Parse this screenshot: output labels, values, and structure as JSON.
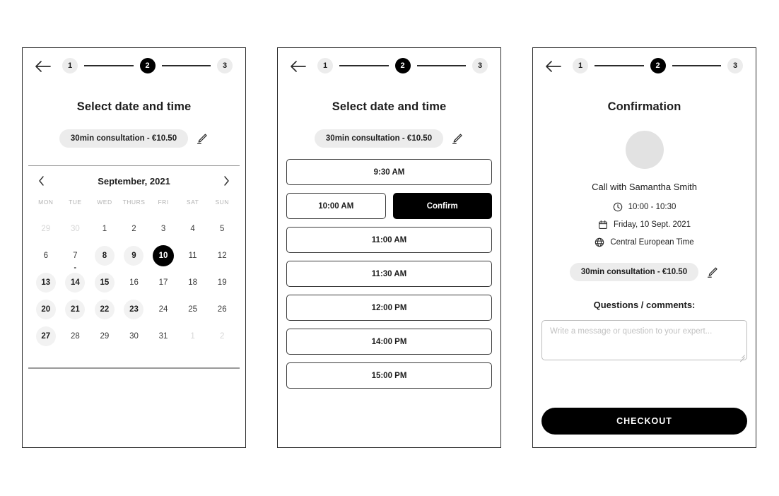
{
  "theme": {
    "background": "#ffffff",
    "card_border": "#2b2b2b",
    "accent_black": "#000000",
    "pill_gray": "#ececec",
    "available_gray": "#f2f2f2",
    "muted_text": "#d6d6d6",
    "avatar_gray": "#e2e2e2"
  },
  "panel1": {
    "back_icon": "arrow-left-icon",
    "steps": [
      {
        "label": "1",
        "active": false
      },
      {
        "label": "2",
        "active": true
      },
      {
        "label": "3",
        "active": false
      }
    ],
    "title": "Select date and time",
    "service_pill": "30min consultation - €10.50",
    "edit_icon": "pencil-icon",
    "calendar": {
      "prev_icon": "chevron-left-icon",
      "next_icon": "chevron-right-icon",
      "month_label": "September, 2021",
      "weekdays": [
        "MON",
        "TUE",
        "WED",
        "THURS",
        "FRI",
        "SAT",
        "SUN"
      ],
      "weeks": [
        [
          {
            "n": "29",
            "state": "muted"
          },
          {
            "n": "30",
            "state": "muted"
          },
          {
            "n": "1",
            "state": "normal"
          },
          {
            "n": "2",
            "state": "normal"
          },
          {
            "n": "3",
            "state": "normal"
          },
          {
            "n": "4",
            "state": "normal"
          },
          {
            "n": "5",
            "state": "normal"
          }
        ],
        [
          {
            "n": "6",
            "state": "normal"
          },
          {
            "n": "7",
            "state": "normal",
            "dot": true
          },
          {
            "n": "8",
            "state": "avail"
          },
          {
            "n": "9",
            "state": "avail"
          },
          {
            "n": "10",
            "state": "selected"
          },
          {
            "n": "11",
            "state": "normal"
          },
          {
            "n": "12",
            "state": "normal"
          }
        ],
        [
          {
            "n": "13",
            "state": "avail"
          },
          {
            "n": "14",
            "state": "avail"
          },
          {
            "n": "15",
            "state": "avail"
          },
          {
            "n": "16",
            "state": "normal"
          },
          {
            "n": "17",
            "state": "normal"
          },
          {
            "n": "18",
            "state": "normal"
          },
          {
            "n": "19",
            "state": "normal"
          }
        ],
        [
          {
            "n": "20",
            "state": "avail"
          },
          {
            "n": "21",
            "state": "avail"
          },
          {
            "n": "22",
            "state": "avail"
          },
          {
            "n": "23",
            "state": "avail"
          },
          {
            "n": "24",
            "state": "normal"
          },
          {
            "n": "25",
            "state": "normal"
          },
          {
            "n": "26",
            "state": "normal"
          }
        ],
        [
          {
            "n": "27",
            "state": "avail"
          },
          {
            "n": "28",
            "state": "normal"
          },
          {
            "n": "29",
            "state": "normal"
          },
          {
            "n": "30",
            "state": "normal"
          },
          {
            "n": "31",
            "state": "normal"
          },
          {
            "n": "1",
            "state": "muted"
          },
          {
            "n": "2",
            "state": "muted"
          }
        ]
      ]
    }
  },
  "panel2": {
    "back_icon": "arrow-left-icon",
    "steps": [
      {
        "label": "1",
        "active": false
      },
      {
        "label": "2",
        "active": true
      },
      {
        "label": "3",
        "active": false
      }
    ],
    "title": "Select date and time",
    "service_pill": "30min consultation - €10.50",
    "edit_icon": "pencil-icon",
    "slots": [
      {
        "label": "9:30 AM",
        "selected": false
      },
      {
        "label": "10:00 AM",
        "selected": true,
        "confirm_label": "Confirm"
      },
      {
        "label": "11:00 AM",
        "selected": false
      },
      {
        "label": "11:30 AM",
        "selected": false
      },
      {
        "label": "12:00 PM",
        "selected": false
      },
      {
        "label": "14:00 PM",
        "selected": false
      },
      {
        "label": "15:00 PM",
        "selected": false
      }
    ]
  },
  "panel3": {
    "back_icon": "arrow-left-icon",
    "steps": [
      {
        "label": "1",
        "active": false
      },
      {
        "label": "2",
        "active": true
      },
      {
        "label": "3",
        "active": false
      }
    ],
    "title": "Confirmation",
    "avatar": "avatar-placeholder",
    "meeting_name": "Call with Samantha Smith",
    "details": [
      {
        "icon": "clock-icon",
        "text": "10:00 - 10:30"
      },
      {
        "icon": "calendar-icon",
        "text": "Friday, 10 Sept. 2021"
      },
      {
        "icon": "globe-icon",
        "text": "Central European Time"
      }
    ],
    "service_pill": "30min consultation - €10.50",
    "edit_icon": "pencil-icon",
    "questions_label": "Questions / comments:",
    "questions_placeholder": "Write a message or question to your expert...",
    "questions_value": "",
    "checkout_label": "CHECKOUT"
  }
}
